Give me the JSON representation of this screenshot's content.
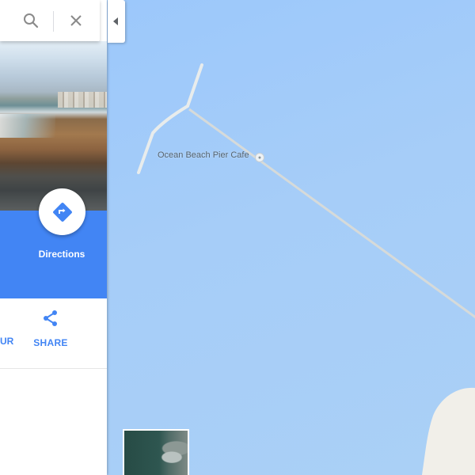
{
  "panel": {
    "directions_label": "Directions",
    "actions": {
      "partial_label": "UR",
      "share_label": "SHARE"
    }
  },
  "map": {
    "poi_label": "Ocean Beach Pier Cafe",
    "poi_icon": "restaurant-icon",
    "water_color": "#a6cdf8",
    "pier_color": "#d6dad9"
  },
  "colors": {
    "accent_blue": "#4285f4"
  }
}
